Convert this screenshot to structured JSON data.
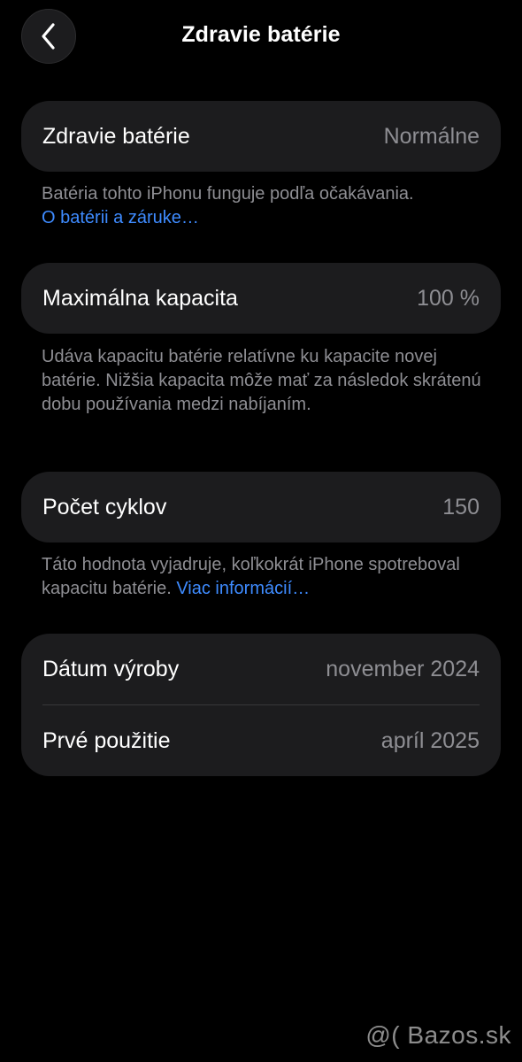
{
  "nav": {
    "title": "Zdravie batérie"
  },
  "health": {
    "label": "Zdravie batérie",
    "value": "Normálne",
    "note": "Batéria tohto iPhonu funguje podľa očakávania.",
    "link": "O batérii a záruke…"
  },
  "capacity": {
    "label": "Maximálna kapacita",
    "value": "100 %",
    "note": "Udáva kapacitu batérie relatívne ku kapacite novej batérie. Nižšia kapacita môže mať za následok skrátenú dobu používania medzi nabíjaním."
  },
  "cycles": {
    "label": "Počet cyklov",
    "value": "150",
    "note": "Táto hodnota vyjadruje, koľkokrát iPhone spotreboval kapacitu batérie.",
    "link": "Viac informácií…"
  },
  "dates": {
    "manufacture_label": "Dátum výroby",
    "manufacture_value": "november 2024",
    "first_use_label": "Prvé použitie",
    "first_use_value": "apríl 2025"
  },
  "watermark": "@( Bazos.sk",
  "colors": {
    "background": "#000000",
    "card": "#1c1c1e",
    "secondary_text": "#8e8e93",
    "link": "#3e8bff"
  },
  "icons": {
    "back": "chevron-left-icon"
  }
}
